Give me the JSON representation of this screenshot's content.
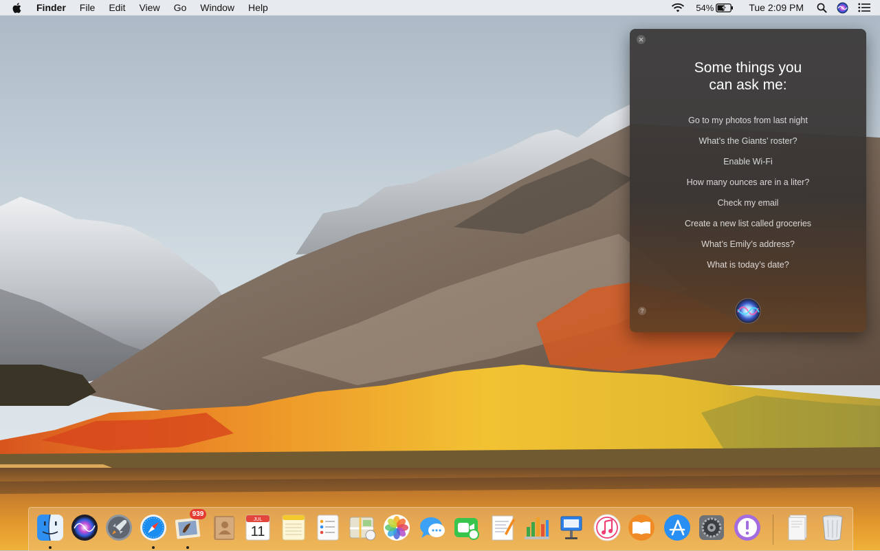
{
  "menu_bar": {
    "apple_icon": "apple-icon",
    "app_name": "Finder",
    "menus": [
      "File",
      "Edit",
      "View",
      "Go",
      "Window",
      "Help"
    ],
    "battery_percent": "54%",
    "clock": "Tue 2:09 PM",
    "status_icons": [
      "wifi-icon",
      "battery-charging-icon",
      "spotlight-search-icon",
      "siri-icon",
      "notification-center-icon"
    ]
  },
  "siri_panel": {
    "title_line1": "Some things you",
    "title_line2": "can ask me:",
    "suggestions": [
      "Go to my photos from last night",
      "What’s the Giants’ roster?",
      "Enable Wi-Fi",
      "How many ounces are in a liter?",
      "Check my email",
      "Create a new list called groceries",
      "What’s Emily’s address?",
      "What is today’s date?"
    ],
    "help_label": "?"
  },
  "dock": {
    "apps": [
      {
        "name": "Finder",
        "icon": "finder-icon",
        "running": true
      },
      {
        "name": "Siri",
        "icon": "siri-icon",
        "running": false
      },
      {
        "name": "Launchpad",
        "icon": "launchpad-icon",
        "running": false
      },
      {
        "name": "Safari",
        "icon": "safari-icon",
        "running": true
      },
      {
        "name": "Mail",
        "icon": "mail-icon",
        "running": true,
        "badge": "939"
      },
      {
        "name": "Contacts",
        "icon": "contacts-icon",
        "running": false
      },
      {
        "name": "Calendar",
        "icon": "calendar-icon",
        "running": false,
        "month": "JUL",
        "day": "11"
      },
      {
        "name": "Notes",
        "icon": "notes-icon",
        "running": false
      },
      {
        "name": "Reminders",
        "icon": "reminders-icon",
        "running": false
      },
      {
        "name": "Maps",
        "icon": "maps-icon",
        "running": false
      },
      {
        "name": "Photos",
        "icon": "photos-icon",
        "running": false
      },
      {
        "name": "Messages",
        "icon": "messages-icon",
        "running": false
      },
      {
        "name": "FaceTime",
        "icon": "facetime-icon",
        "running": false
      },
      {
        "name": "Pages",
        "icon": "pages-icon",
        "running": false
      },
      {
        "name": "Numbers",
        "icon": "numbers-icon",
        "running": false
      },
      {
        "name": "Keynote",
        "icon": "keynote-icon",
        "running": false
      },
      {
        "name": "iTunes",
        "icon": "itunes-icon",
        "running": false
      },
      {
        "name": "iBooks",
        "icon": "ibooks-icon",
        "running": false
      },
      {
        "name": "App Store",
        "icon": "app-store-icon",
        "running": false
      },
      {
        "name": "System Preferences",
        "icon": "system-preferences-icon",
        "running": false
      },
      {
        "name": "Feedback Assistant",
        "icon": "feedback-assistant-icon",
        "running": false
      },
      {
        "name": "Documents",
        "icon": "documents-stack-icon",
        "running": false
      },
      {
        "name": "Trash",
        "icon": "trash-icon",
        "running": false
      }
    ]
  },
  "colors": {
    "menu_bar_bg": "#eceef1",
    "siri_panel_bg": "#3e3c3c",
    "dock_bg": "#eebe80",
    "badge_red": "#e43b32",
    "autumn_orange": "#e8832a",
    "autumn_yellow": "#f2c233"
  }
}
